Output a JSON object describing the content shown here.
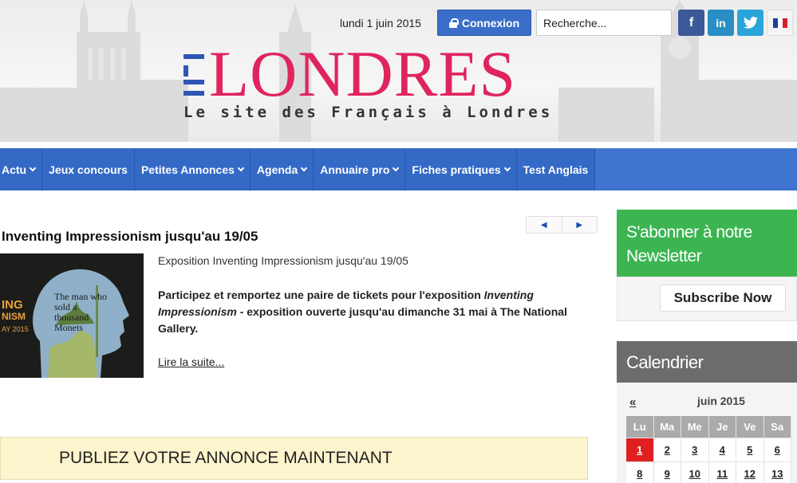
{
  "header": {
    "date": "lundi 1 juin 2015",
    "login_label": "Connexion",
    "search_placeholder": "Recherche...",
    "social": {
      "facebook": "f",
      "linkedin": "in",
      "twitter": "twitter-icon",
      "language": "french-flag-icon"
    },
    "logo": {
      "prefix": "ICI",
      "name": "LONDRES",
      "tagline": "Le site des Français à Londres"
    }
  },
  "nav": [
    {
      "label": "Actu",
      "dropdown": true
    },
    {
      "label": "Jeux concours",
      "dropdown": false
    },
    {
      "label": "Petites Annonces",
      "dropdown": true
    },
    {
      "label": "Agenda",
      "dropdown": true
    },
    {
      "label": "Annuaire pro",
      "dropdown": true
    },
    {
      "label": "Fiches pratiques",
      "dropdown": true
    },
    {
      "label": "Test Anglais",
      "dropdown": false
    }
  ],
  "article": {
    "title": "Inventing Impressionism jusqu'au 19/05",
    "subtitle": "Exposition Inventing Impressionism jusqu'au 19/05",
    "body_1": "Participez et remportez une paire de tickets pour l'exposition ",
    "body_italic": "Inventing Impressionism",
    "body_2": " - exposition ouverte jusqu'au dimanche 31 mai à The National Gallery.",
    "read_more": "Lire la suite...",
    "image": {
      "side_text_1": "ING",
      "side_text_2": "NISM",
      "side_text_3": "AY 2015",
      "quote": "The man who sold a thousand Monets"
    }
  },
  "publiez": "PUBLIEZ VOTRE ANNONCE MAINTENANT",
  "newsletter": {
    "title": "S'abonner à notre Newsletter",
    "button": "Subscribe Now"
  },
  "calendar": {
    "title": "Calendrier",
    "prev": "«",
    "month": "juin 2015",
    "days_of_week": [
      "Lu",
      "Ma",
      "Me",
      "Je",
      "Ve",
      "Sa"
    ],
    "weeks": [
      [
        "1",
        "2",
        "3",
        "4",
        "5",
        "6"
      ],
      [
        "8",
        "9",
        "10",
        "11",
        "12",
        "13"
      ]
    ],
    "today": "1"
  },
  "colors": {
    "brand_pink": "#e0245e",
    "nav_blue": "#3469c6",
    "newsletter_green": "#3cb551",
    "calendar_gray": "#6c6c6c",
    "today_red": "#e02020"
  }
}
